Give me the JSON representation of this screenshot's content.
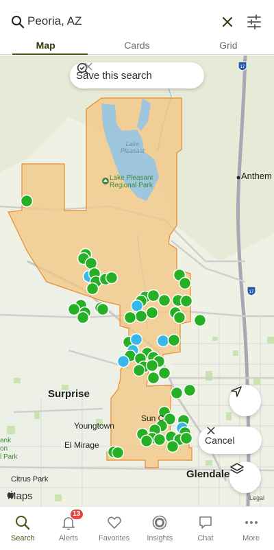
{
  "search": {
    "query": "Peoria, AZ"
  },
  "tabs": [
    {
      "label": "Map",
      "active": true
    },
    {
      "label": "Cards",
      "active": false
    },
    {
      "label": "Grid",
      "active": false
    }
  ],
  "map": {
    "save_search_label": "Save this search",
    "cancel_label": "Cancel",
    "attribution": "Maps",
    "legal": "Legal",
    "highway_shield": "17",
    "labels": {
      "lake_pleasant": "Lake\nPleasant",
      "park": "Lake Pleasant\nRegional Park",
      "anthem": "Anthem",
      "surprise": "Surprise",
      "youngtown": "Youngtown",
      "sun_city": "Sun C",
      "el_mirage": "El Mirage",
      "glendale": "Glendale",
      "citrus_park": "Citrus Park",
      "left_park": "ank\non\nl Park"
    },
    "colors": {
      "boundary_fill": "#f4c37d",
      "boundary_stroke": "#e98a2c",
      "listing_green": "#25b025",
      "listing_blue": "#36b8ea",
      "water": "#9ec7dd",
      "accent": "#4a5418"
    }
  },
  "nav": [
    {
      "label": "Search",
      "active": true
    },
    {
      "label": "Alerts",
      "badge": "13"
    },
    {
      "label": "Favorites"
    },
    {
      "label": "Insights"
    },
    {
      "label": "Chat"
    },
    {
      "label": "More"
    }
  ]
}
